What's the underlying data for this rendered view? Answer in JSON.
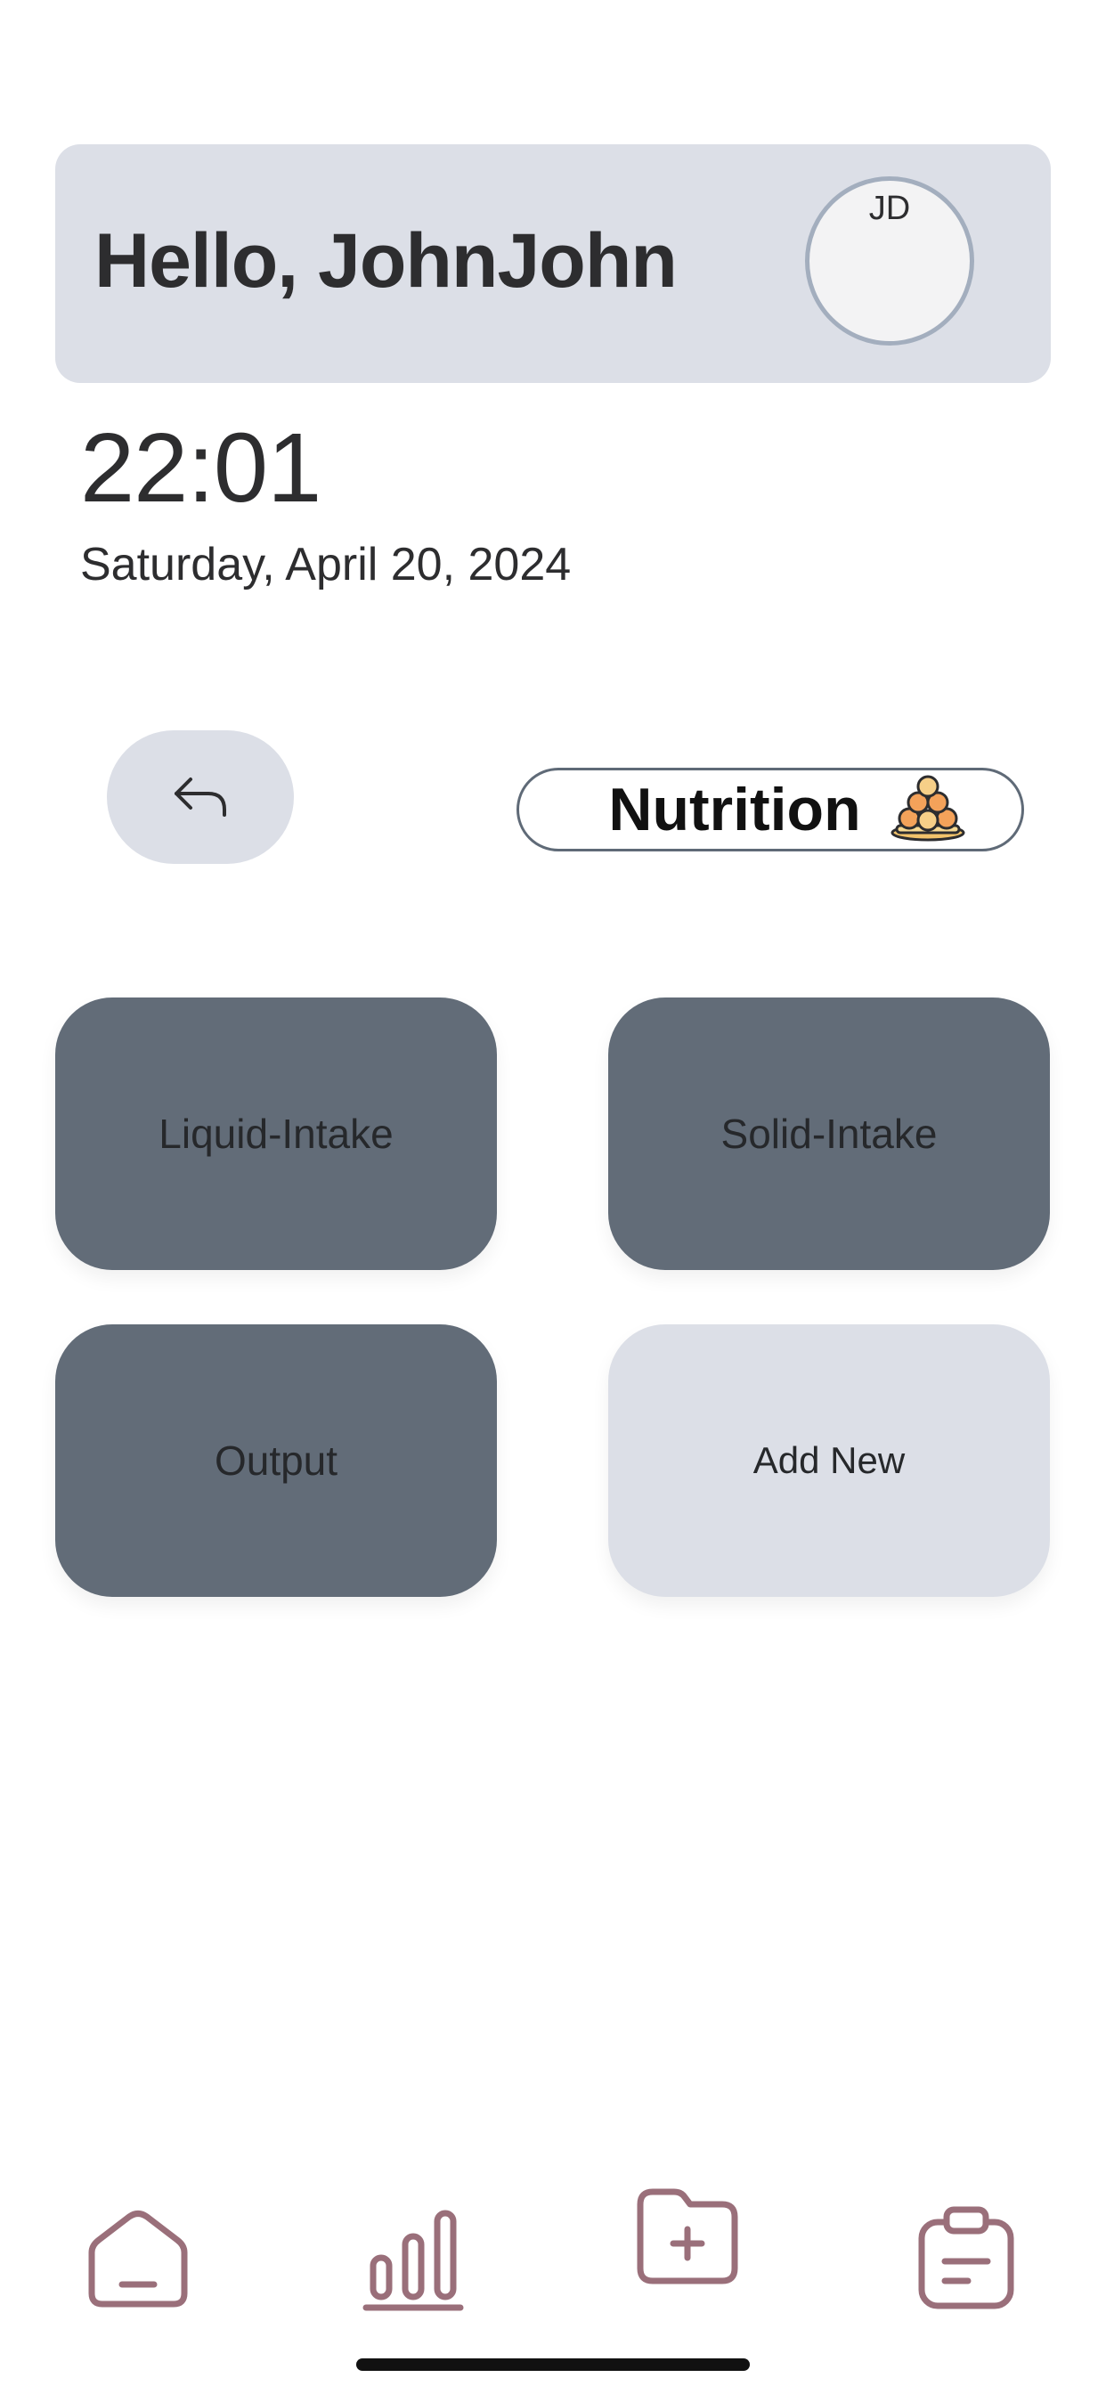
{
  "header": {
    "greeting": "Hello, JohnJohn",
    "avatar_initials": "JD"
  },
  "clock": {
    "time": "22:01",
    "date": "Saturday, April 20, 2024"
  },
  "section": {
    "title": "Nutrition",
    "icon": "food-bowl-icon"
  },
  "tiles": [
    {
      "label": "Liquid-Intake",
      "style": "dark"
    },
    {
      "label": "Solid-Intake",
      "style": "dark"
    },
    {
      "label": "Output",
      "style": "dark"
    },
    {
      "label": "Add New",
      "style": "light"
    }
  ],
  "nav": {
    "items": [
      {
        "icon": "home-icon"
      },
      {
        "icon": "bar-chart-icon"
      },
      {
        "icon": "folder-add-icon"
      },
      {
        "icon": "clipboard-icon"
      }
    ],
    "icon_color": "#9a6f7a"
  },
  "colors": {
    "card_bg": "#dcdfe7",
    "tile_dark": "#626c78",
    "tile_light": "#dcdfe7"
  }
}
